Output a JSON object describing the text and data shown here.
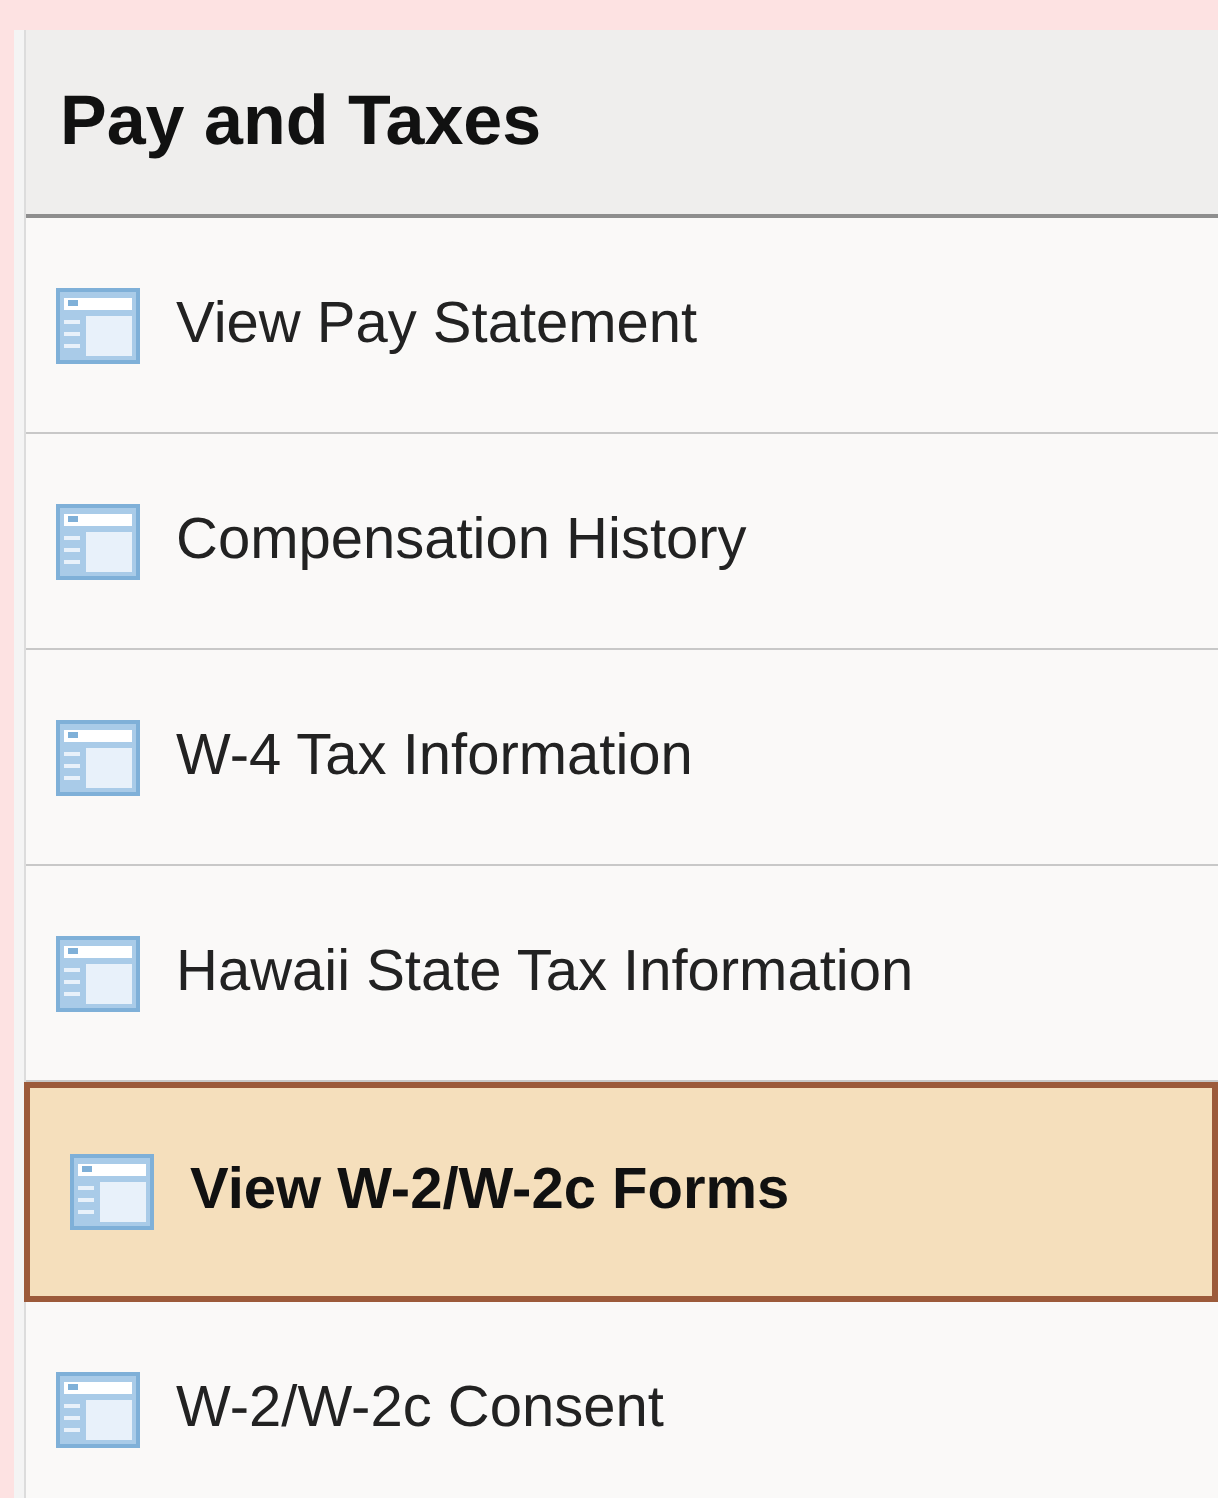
{
  "panel": {
    "title": "Pay and Taxes"
  },
  "items": [
    {
      "label": "View Pay Statement",
      "selected": false
    },
    {
      "label": "Compensation History",
      "selected": false
    },
    {
      "label": "W-4 Tax Information",
      "selected": false
    },
    {
      "label": "Hawaii State Tax Information",
      "selected": false
    },
    {
      "label": "View W-2/W-2c Forms",
      "selected": true
    },
    {
      "label": "W-2/W-2c Consent",
      "selected": false
    }
  ]
}
